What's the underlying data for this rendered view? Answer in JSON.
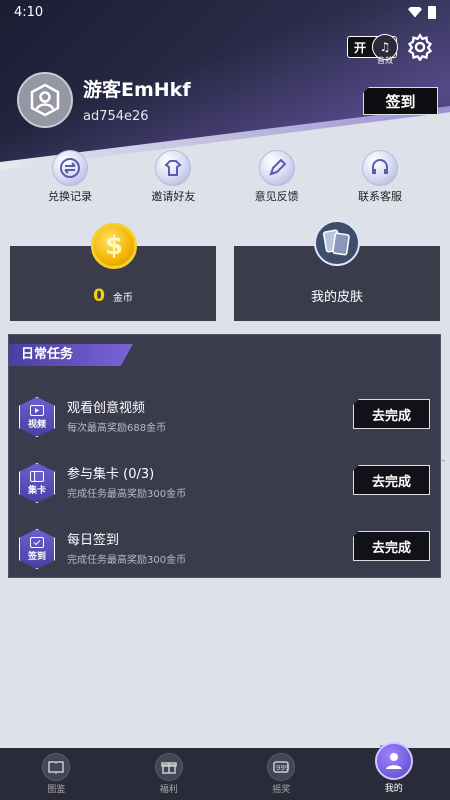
{
  "status_bar": {
    "time": "4:10"
  },
  "header": {
    "sound_toggle": {
      "state": "开",
      "label": "音效"
    },
    "username": "游客EmHkf",
    "user_id": "ad754e26",
    "signin_button": "签到"
  },
  "quick_actions": [
    {
      "label": "兑换记录",
      "icon": "exchange-icon"
    },
    {
      "label": "邀请好友",
      "icon": "gift-shirt-icon"
    },
    {
      "label": "意见反馈",
      "icon": "pencil-icon"
    },
    {
      "label": "联系客服",
      "icon": "headset-icon"
    }
  ],
  "cards": {
    "coins": {
      "value": "0",
      "unit": "金币",
      "icon": "coin-icon"
    },
    "skin": {
      "label": "我的皮肤",
      "icon": "skin-icon"
    }
  },
  "daily_tasks": {
    "title": "日常任务",
    "items": [
      {
        "badge": "视频",
        "title": "观看创意视频",
        "desc": "每次最高奖励688金币",
        "button": "去完成"
      },
      {
        "badge": "集卡",
        "title": "参与集卡 (0/3)",
        "desc": "完成任务最高奖励300金币",
        "button": "去完成"
      },
      {
        "badge": "签到",
        "title": "每日签到",
        "desc": "完成任务最高奖励300金币",
        "button": "去完成"
      }
    ]
  },
  "bottom_nav": [
    {
      "label": "图鉴",
      "icon": "book-icon",
      "active": false
    },
    {
      "label": "福利",
      "icon": "gift-icon",
      "active": false
    },
    {
      "label": "摇奖",
      "icon": "lottery-icon",
      "active": false
    },
    {
      "label": "我的",
      "icon": "profile-icon",
      "active": true
    }
  ],
  "watermark": "d754e26"
}
